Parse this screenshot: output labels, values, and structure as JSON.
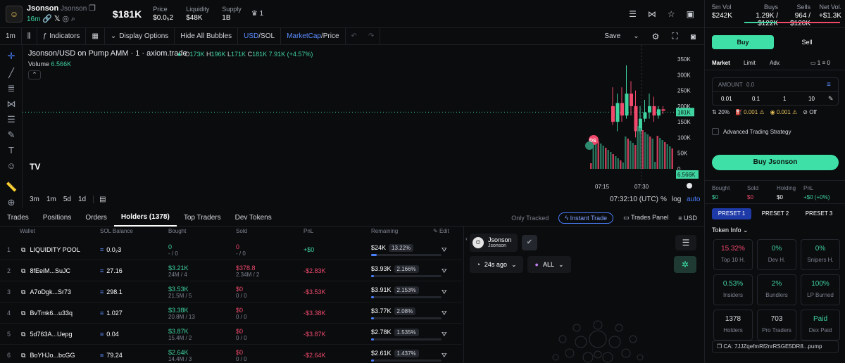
{
  "token": {
    "name": "Jsonson",
    "ticker": "Jsonson",
    "age": "16m",
    "mcap": "$181K"
  },
  "stats": [
    {
      "label": "Price",
      "value": "$0.0₅2"
    },
    {
      "label": "Liquidity",
      "value": "$48K"
    },
    {
      "label": "Supply",
      "value": "1B"
    }
  ],
  "holders_icon_count": "1",
  "toolbar": {
    "interval": "1m",
    "indicators": "Indicators",
    "display": "Display Options",
    "hide": "Hide All Bubbles",
    "usd": "USD",
    "sol": "SOL",
    "mcap": "MarketCap",
    "price": "Price",
    "save": "Save"
  },
  "chart": {
    "title": "Jsonson/USD on Pump AMM · 1 · axiom.trade",
    "o": "173K",
    "h": "196K",
    "l": "171K",
    "c": "181K",
    "chg": "7.91K (+4.57%)",
    "volume_label": "Volume",
    "volume_value": "6.566K",
    "yticks": [
      "350K",
      "300K",
      "250K",
      "200K",
      "150K",
      "100K",
      "50K",
      "0"
    ],
    "current_price_tag": "181K",
    "current_vol_tag": "6.566K",
    "xticks": [
      "07:15",
      "07:30"
    ],
    "time": "07:32:10 (UTC)",
    "pct": "%",
    "log": "log",
    "auto": "auto",
    "ranges": [
      "3m",
      "1m",
      "5d",
      "1d"
    ],
    "marker": "DS"
  },
  "tabs": [
    "Trades",
    "Positions",
    "Orders",
    "Holders (1378)",
    "Top Traders",
    "Dev Tokens"
  ],
  "tab_right": {
    "only_tracked": "Only Tracked",
    "instant": "Instant Trade",
    "panel": "Trades Panel",
    "usd": "USD"
  },
  "table": {
    "headers": [
      "Wallet",
      "SOL Balance",
      "Bought",
      "Sold",
      "PnL",
      "Remaining",
      "Edit"
    ],
    "rows": [
      {
        "n": "1",
        "wallet": "LIQUIDITY POOL",
        "sol": "0.0₂3",
        "bought": "0",
        "bought_sub": "- / 0",
        "sold": "0",
        "sold_sub": "- / 0",
        "pnl": "+$0",
        "rem": "$24K",
        "rem_pct": "13.22%",
        "fill": 0.13
      },
      {
        "n": "2",
        "wallet": "8fEeiM...SuJC",
        "sol": "27.16",
        "bought": "$3.21K",
        "bought_sub": "24M / 4",
        "sold": "$378.8",
        "sold_sub": "2.34M / 2",
        "pnl": "-$2.83K",
        "rem": "$3.93K",
        "rem_pct": "2.166%",
        "fill": 0.02
      },
      {
        "n": "3",
        "wallet": "A7oDgk...Sr73",
        "sol": "298.1",
        "bought": "$3.53K",
        "bought_sub": "21.5M / 5",
        "sold": "$0",
        "sold_sub": "0 / 0",
        "pnl": "-$3.53K",
        "rem": "$3.91K",
        "rem_pct": "2.153%",
        "fill": 0.02
      },
      {
        "n": "4",
        "wallet": "BvTmk6...u33q",
        "sol": "1.027",
        "bought": "$3.38K",
        "bought_sub": "20.8M / 13",
        "sold": "$0",
        "sold_sub": "0 / 0",
        "pnl": "-$3.38K",
        "rem": "$3.77K",
        "rem_pct": "2.08%",
        "fill": 0.02
      },
      {
        "n": "5",
        "wallet": "5d763A...Uepg",
        "sol": "0.04",
        "bought": "$3.87K",
        "bought_sub": "15.4M / 2",
        "sold": "$0",
        "sold_sub": "0 / 0",
        "pnl": "-$3.87K",
        "rem": "$2.78K",
        "rem_pct": "1.535%",
        "fill": 0.015
      },
      {
        "n": "6",
        "wallet": "BoYHJo...bcGG",
        "sol": "79.24",
        "bought": "$2.64K",
        "bought_sub": "14.4M / 3",
        "sold": "$0",
        "sold_sub": "0 / 0",
        "pnl": "-$2.64K",
        "rem": "$2.61K",
        "rem_pct": "1.437%",
        "fill": 0.014
      }
    ]
  },
  "mid": {
    "name": "Jsonson",
    "handle": "Jsonson",
    "ago": "24s ago",
    "all": "ALL"
  },
  "right": {
    "vol": [
      {
        "label": "5m Vol",
        "value": "$242K"
      },
      {
        "label": "Buys",
        "value": "1.29K / $122K"
      },
      {
        "label": "Sells",
        "value": "964 / $120K"
      },
      {
        "label": "Net Vol.",
        "value": "+$1.3K"
      }
    ],
    "buy": "Buy",
    "sell": "Sell",
    "modes": [
      "Market",
      "Limit",
      "Adv."
    ],
    "wallets": "1",
    "wallet_bal": "0",
    "amount_label": "AMOUNT",
    "amount_ph": "0.0",
    "quick": [
      "0.01",
      "0.1",
      "1",
      "10"
    ],
    "slip": "20%",
    "prio": "0.001",
    "bribe": "0.001",
    "mev": "Off",
    "adv": "Advanced Trading Strategy",
    "buy_btn": "Buy Jsonson",
    "pos": [
      {
        "label": "Bought",
        "value": "$0"
      },
      {
        "label": "Sold",
        "value": "$0"
      },
      {
        "label": "Holding",
        "value": "$0"
      },
      {
        "label": "PnL",
        "value": "+$0 (+0%)"
      }
    ],
    "presets": [
      "PRESET 1",
      "PRESET 2",
      "PRESET 3"
    ],
    "info_title": "Token Info",
    "info": [
      {
        "v": "15.32%",
        "l": "Top 10 H.",
        "c": "#f0496c"
      },
      {
        "v": "0%",
        "l": "Dev H.",
        "c": "#3fd3a0"
      },
      {
        "v": "0%",
        "l": "Snipers H.",
        "c": "#3fd3a0"
      },
      {
        "v": "0.53%",
        "l": "Insiders",
        "c": "#3fd3a0"
      },
      {
        "v": "2%",
        "l": "Bundlers",
        "c": "#3fd3a0"
      },
      {
        "v": "100%",
        "l": "LP Burned",
        "c": "#3fd3a0"
      },
      {
        "v": "1378",
        "l": "Holders",
        "c": "#d6d8dd"
      },
      {
        "v": "703",
        "l": "Pro Traders",
        "c": "#d6d8dd"
      },
      {
        "v": "Paid",
        "l": "Dex Paid",
        "c": "#3fd3a0"
      }
    ],
    "ca": "CA: 7JJZqefmRf2nrRSGE5DR8...pump"
  }
}
